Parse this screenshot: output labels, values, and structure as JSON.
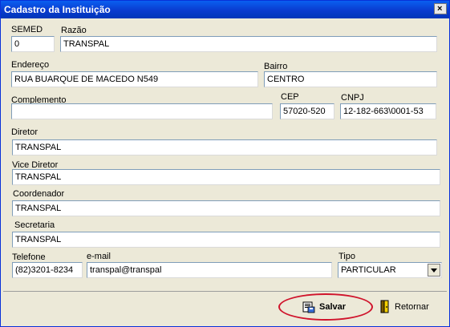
{
  "window": {
    "title": "Cadastro da Instituição"
  },
  "fields": {
    "semed": {
      "label": "SEMED",
      "value": "0"
    },
    "razao": {
      "label": "Razão",
      "value": "TRANSPAL"
    },
    "endereco": {
      "label": "Endereço",
      "value": "RUA BUARQUE DE MACEDO N549"
    },
    "bairro": {
      "label": "Bairro",
      "value": "CENTRO"
    },
    "complemento": {
      "label": "Complemento",
      "value": ""
    },
    "cep": {
      "label": "CEP",
      "value": "57020-520"
    },
    "cnpj": {
      "label": "CNPJ",
      "value": "12-182-663\\0001-53"
    },
    "diretor": {
      "label": "Diretor",
      "value": "TRANSPAL"
    },
    "vice_diretor": {
      "label": "Vice Diretor",
      "value": "TRANSPAL"
    },
    "coordenador": {
      "label": "Coordenador",
      "value": "TRANSPAL"
    },
    "secretaria": {
      "label": "Secretaria",
      "value": "TRANSPAL"
    },
    "telefone": {
      "label": "Telefone",
      "value": "(82)3201-8234"
    },
    "email": {
      "label": "e-mail",
      "value": "transpal@transpal"
    },
    "tipo": {
      "label": "Tipo",
      "value": "PARTICULAR"
    }
  },
  "buttons": {
    "salvar": {
      "label": "Salvar",
      "icon": "save-icon"
    },
    "retornar": {
      "label": "Retornar",
      "icon": "door-exit-icon"
    }
  },
  "colors": {
    "titlebar": "#0A3BCF",
    "highlight": "#D0142C",
    "window_bg": "#ECE9D8"
  }
}
